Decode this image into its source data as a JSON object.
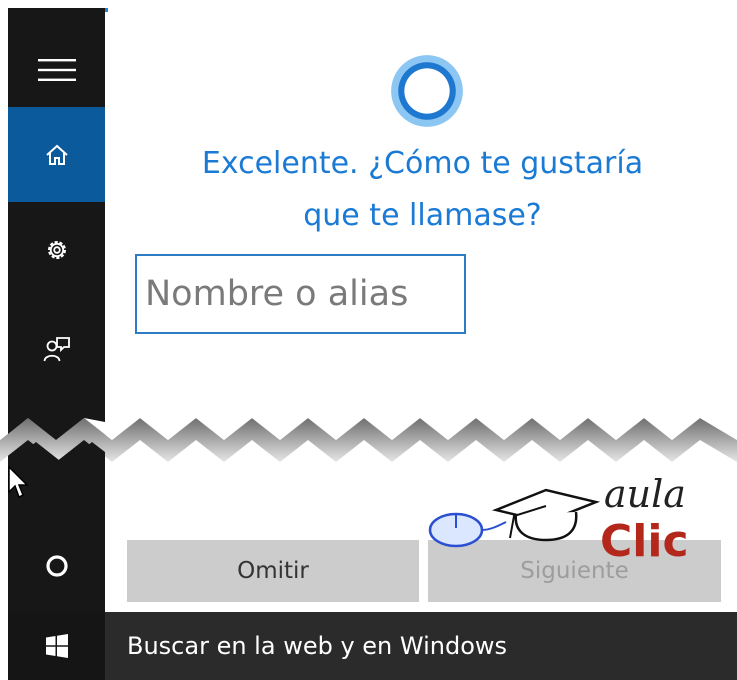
{
  "sidebar": {
    "items": [
      {
        "name": "menu",
        "icon": "hamburger-icon"
      },
      {
        "name": "home",
        "icon": "home-icon"
      },
      {
        "name": "settings",
        "icon": "gear-icon"
      },
      {
        "name": "feedback",
        "icon": "feedback-icon"
      },
      {
        "name": "cortana",
        "icon": "cortana-circle-icon"
      }
    ],
    "active": "home"
  },
  "cortana": {
    "question": "Excelente. ¿Cómo te gustaría que te llamase?",
    "name_placeholder": "Nombre o alias",
    "name_value": ""
  },
  "actions": {
    "skip_label": "Omitir",
    "next_label": "Siguiente"
  },
  "taskbar": {
    "start_icon": "windows-logo-icon",
    "search_text": "Buscar en la web y en Windows"
  },
  "watermark": {
    "line1": "aula",
    "line2": "Clic"
  },
  "colors": {
    "accent": "#1a7ad4",
    "sidebar_active": "#0a5a9c",
    "sidebar_bg": "#171717",
    "taskbar_bg": "#2b2b2b",
    "logo_red": "#b3281a"
  }
}
